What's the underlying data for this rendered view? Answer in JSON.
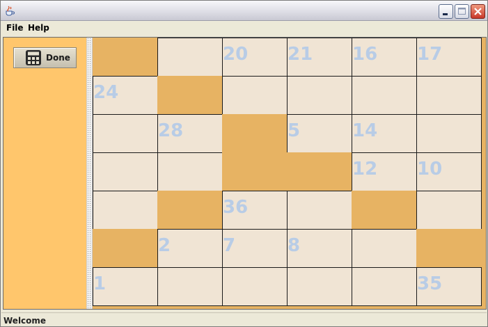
{
  "window": {
    "title": ""
  },
  "menubar": {
    "items": [
      {
        "label": "File"
      },
      {
        "label": "Help"
      }
    ]
  },
  "sidebar": {
    "done_label": "Done"
  },
  "status": {
    "text": "Welcome"
  },
  "puzzle": {
    "rows": 7,
    "cols": 6,
    "cells": [
      [
        {
          "black": true,
          "n": ""
        },
        {
          "black": false,
          "n": ""
        },
        {
          "black": false,
          "n": "20"
        },
        {
          "black": false,
          "n": "21"
        },
        {
          "black": false,
          "n": "16"
        },
        {
          "black": false,
          "n": "17"
        }
      ],
      [
        {
          "black": false,
          "n": "24"
        },
        {
          "black": true,
          "n": ""
        },
        {
          "black": false,
          "n": ""
        },
        {
          "black": false,
          "n": ""
        },
        {
          "black": false,
          "n": ""
        },
        {
          "black": false,
          "n": ""
        }
      ],
      [
        {
          "black": false,
          "n": ""
        },
        {
          "black": false,
          "n": "28"
        },
        {
          "black": true,
          "n": ""
        },
        {
          "black": false,
          "n": "5"
        },
        {
          "black": false,
          "n": "14"
        },
        {
          "black": false,
          "n": ""
        }
      ],
      [
        {
          "black": false,
          "n": ""
        },
        {
          "black": false,
          "n": ""
        },
        {
          "black": true,
          "n": ""
        },
        {
          "black": true,
          "n": ""
        },
        {
          "black": false,
          "n": "12"
        },
        {
          "black": false,
          "n": "10"
        }
      ],
      [
        {
          "black": false,
          "n": ""
        },
        {
          "black": true,
          "n": ""
        },
        {
          "black": false,
          "n": "36"
        },
        {
          "black": false,
          "n": ""
        },
        {
          "black": true,
          "n": ""
        },
        {
          "black": false,
          "n": ""
        }
      ],
      [
        {
          "black": true,
          "n": ""
        },
        {
          "black": false,
          "n": "2"
        },
        {
          "black": false,
          "n": "7"
        },
        {
          "black": false,
          "n": "8"
        },
        {
          "black": false,
          "n": ""
        },
        {
          "black": true,
          "n": ""
        }
      ],
      [
        {
          "black": false,
          "n": "1"
        },
        {
          "black": false,
          "n": ""
        },
        {
          "black": false,
          "n": ""
        },
        {
          "black": false,
          "n": ""
        },
        {
          "black": false,
          "n": ""
        },
        {
          "black": false,
          "n": "35"
        }
      ]
    ]
  },
  "colors": {
    "panel": "#ffc66c",
    "blocked": "#e7b363",
    "cell": "#f0e4d4",
    "number": "#b8cce6"
  }
}
